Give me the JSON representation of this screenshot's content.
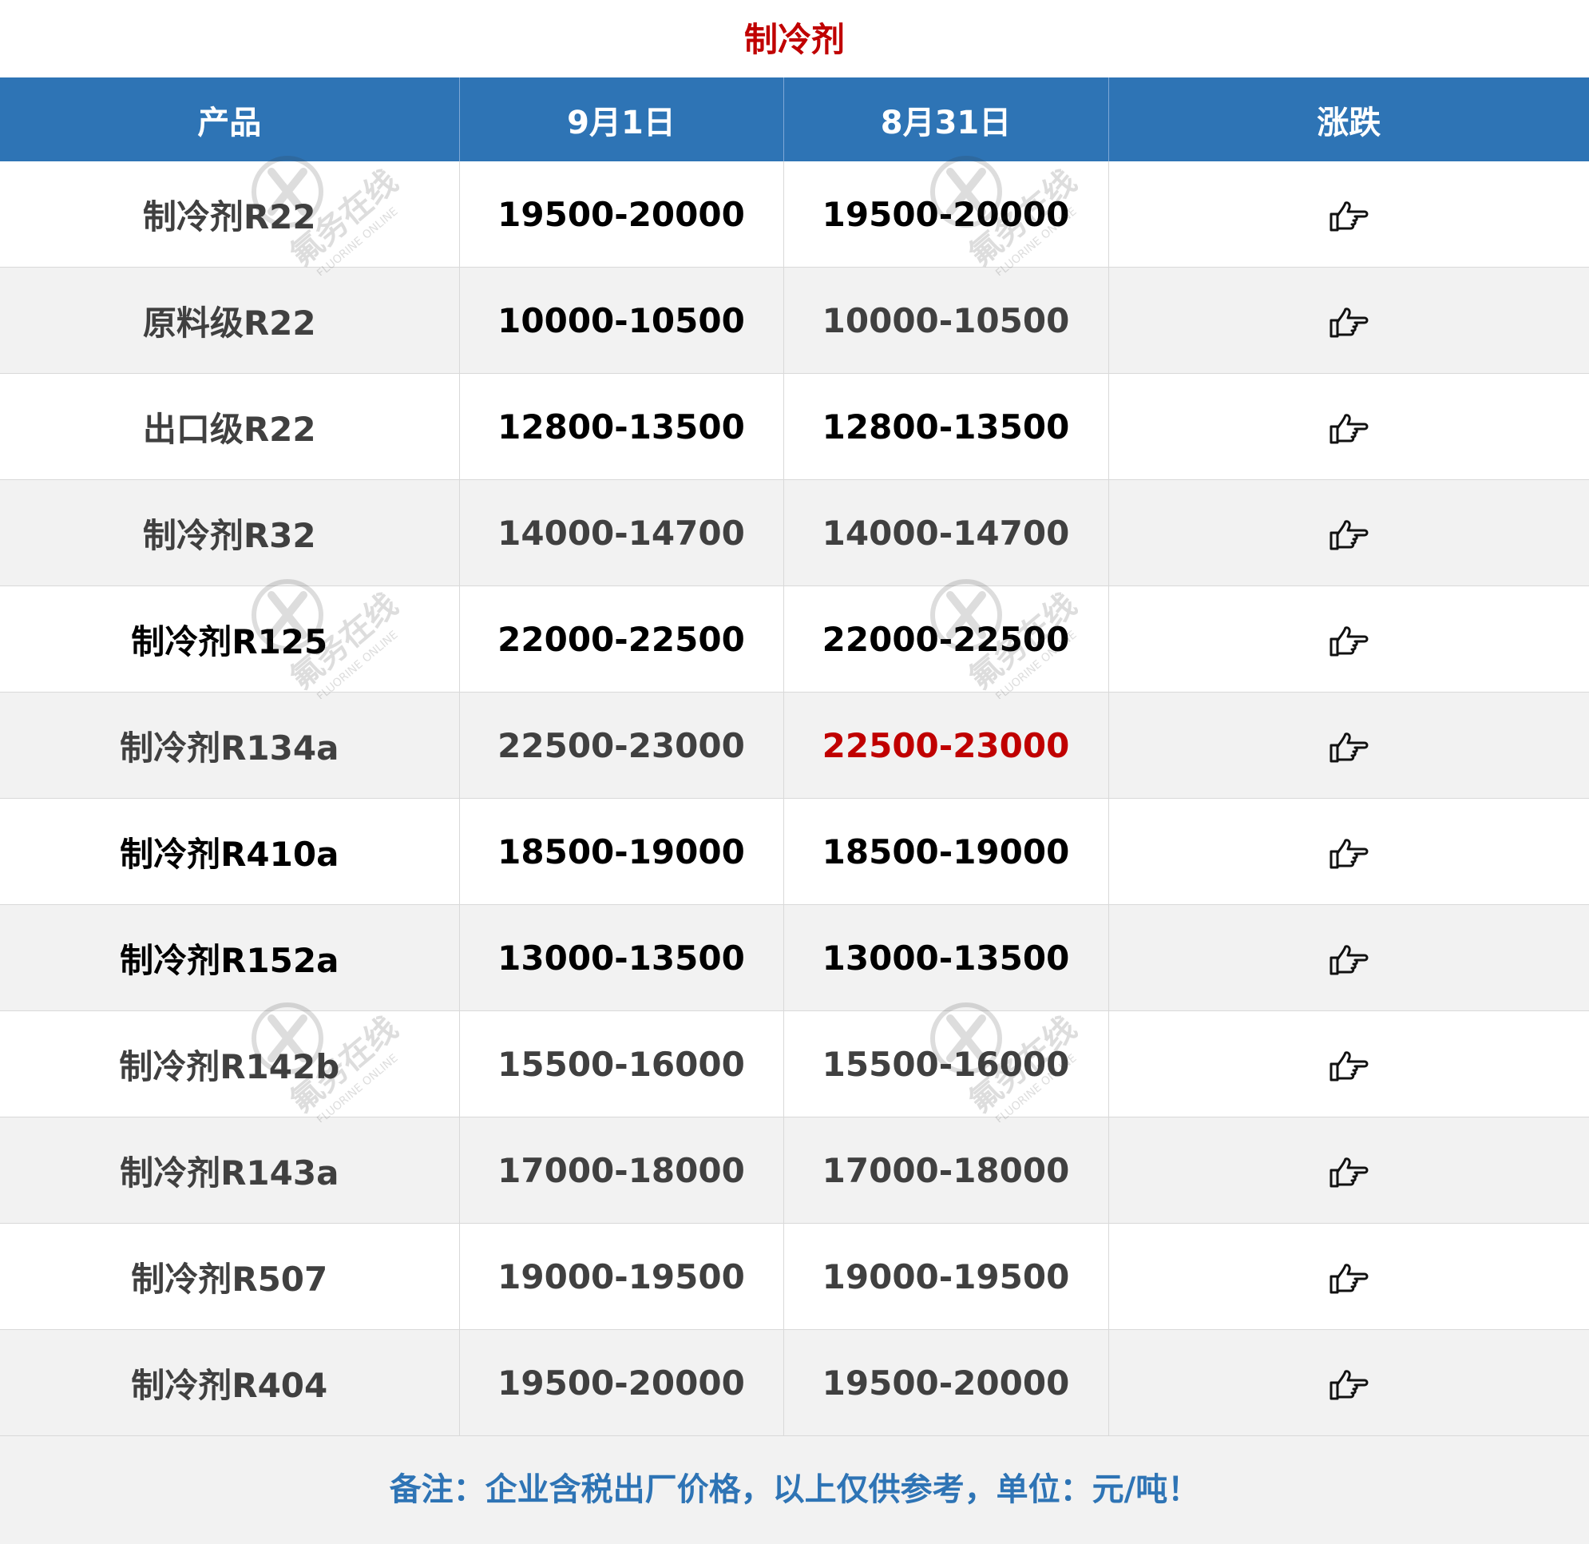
{
  "title": "制冷剂",
  "headers": [
    "产品",
    "9月1日",
    "8月31日",
    "涨跌"
  ],
  "rows": [
    {
      "product": "制冷剂R22",
      "sep1": "19500-20000",
      "aug31": "19500-20000",
      "trend": "pointing-hand-icon"
    },
    {
      "product": "原料级R22",
      "sep1": "10000-10500",
      "aug31": "10000-10500",
      "trend": "pointing-hand-icon"
    },
    {
      "product": "出口级R22",
      "sep1": "12800-13500",
      "aug31": "12800-13500",
      "trend": "pointing-hand-icon"
    },
    {
      "product": "制冷剂R32",
      "sep1": "14000-14700",
      "aug31": "14000-14700",
      "trend": "pointing-hand-icon"
    },
    {
      "product": "制冷剂R125",
      "sep1": "22000-22500",
      "aug31": "22000-22500",
      "trend": "pointing-hand-icon"
    },
    {
      "product": "制冷剂R134a",
      "sep1": "22500-23000",
      "aug31": "22500-23000",
      "trend": "pointing-hand-icon"
    },
    {
      "product": "制冷剂R410a",
      "sep1": "18500-19000",
      "aug31": "18500-19000",
      "trend": "pointing-hand-icon"
    },
    {
      "product": "制冷剂R152a",
      "sep1": "13000-13500",
      "aug31": "13000-13500",
      "trend": "pointing-hand-icon"
    },
    {
      "product": "制冷剂R142b",
      "sep1": "15500-16000",
      "aug31": "15500-16000",
      "trend": "pointing-hand-icon"
    },
    {
      "product": "制冷剂R143a",
      "sep1": "17000-18000",
      "aug31": "17000-18000",
      "trend": "pointing-hand-icon"
    },
    {
      "product": "制冷剂R507",
      "sep1": "19000-19500",
      "aug31": "19000-19500",
      "trend": "pointing-hand-icon"
    },
    {
      "product": "制冷剂R404",
      "sep1": "19500-20000",
      "aug31": "19500-20000",
      "trend": "pointing-hand-icon"
    }
  ],
  "footer": "备注：企业含税出厂价格，以上仅供参考，单位：元/吨！",
  "watermark": {
    "cn": "氟务在线",
    "en": "FLUORINE ONLINE"
  },
  "colors": {
    "header_bg": "#2e74b5",
    "title_red": "#c00000",
    "highlight_red": "#c00000",
    "note_blue": "#2e74b5",
    "row_alt_bg": "#f2f2f2"
  }
}
